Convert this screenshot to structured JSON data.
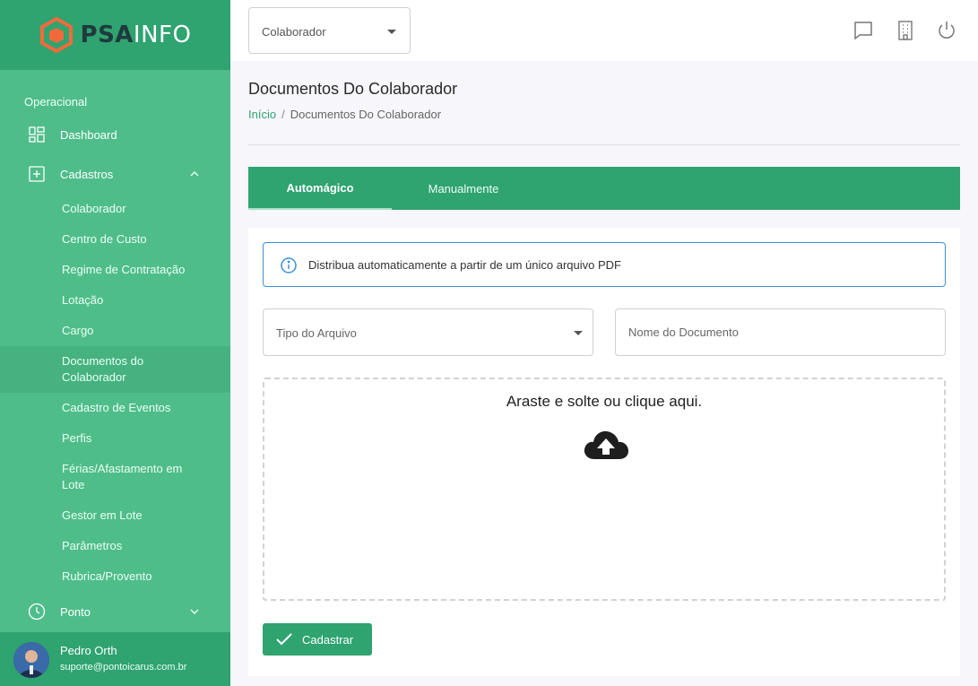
{
  "brand": {
    "logo_bold": "PSA",
    "logo_thin": "INFO"
  },
  "sidebar": {
    "section": "Operacional",
    "items": [
      {
        "label": "Dashboard"
      },
      {
        "label": "Cadastros"
      },
      {
        "label": "Ponto"
      }
    ],
    "cadastros_children": [
      "Colaborador",
      "Centro de Custo",
      "Regime de Contratação",
      "Lotação",
      "Cargo",
      "Documentos do Colaborador",
      "Cadastro de Eventos",
      "Perfis",
      "Férias/Afastamento em Lote",
      "Gestor em Lote",
      "Parâmetros",
      "Rubrica/Provento"
    ],
    "user": {
      "name": "Pedro Orth",
      "email": "suporte@pontoicarus.com.br"
    }
  },
  "topbar": {
    "context_select": "Colaborador"
  },
  "page": {
    "title": "Documentos Do Colaborador",
    "breadcrumb_home": "Início",
    "breadcrumb_current": "Documentos Do Colaborador"
  },
  "tabs": [
    {
      "label": "Automágico",
      "active": true
    },
    {
      "label": "Manualmente",
      "active": false
    }
  ],
  "form": {
    "info_text": "Distribua automaticamente a partir de um único arquivo PDF",
    "file_type_placeholder": "Tipo do Arquivo",
    "doc_name_placeholder": "Nome do Documento",
    "dropzone_text": "Araste e solte ou clique aqui.",
    "submit_label": "Cadastrar"
  },
  "colors": {
    "primary": "#2fa370",
    "sidebar": "#4fbd8a",
    "info_border": "#3d8fd6",
    "logo_orange": "#f26a3c"
  }
}
